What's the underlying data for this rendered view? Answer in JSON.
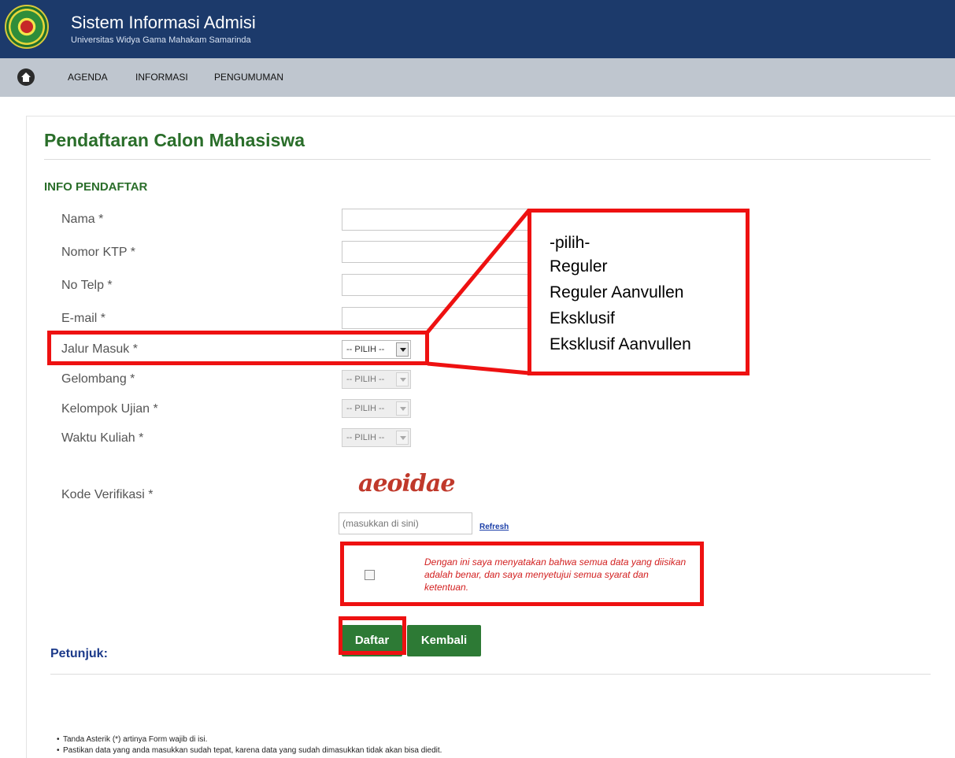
{
  "header": {
    "title": "Sistem Informasi Admisi",
    "subtitle": "Universitas Widya Gama Mahakam Samarinda"
  },
  "nav": {
    "items": [
      "AGENDA",
      "INFORMASI",
      "PENGUMUMAN"
    ]
  },
  "page": {
    "title": "Pendaftaran Calon Mahasiswa",
    "section": "INFO PENDAFTAR"
  },
  "form": {
    "nama_label": "Nama *",
    "ktp_label": "Nomor KTP *",
    "telp_label": "No Telp *",
    "email_label": "E-mail *",
    "jalur_label": "Jalur Masuk *",
    "gelombang_label": "Gelombang *",
    "kelompok_label": "Kelompok Ujian *",
    "waktu_label": "Waktu Kuliah *",
    "kode_label": "Kode Verifikasi *",
    "select_default": "-- PILIH --",
    "captcha_text": "aeoidae",
    "captcha_placeholder": "(masukkan di sini)",
    "refresh_label": "Refresh",
    "agreement": "Dengan ini saya menyatakan bahwa semua data yang diisikan adalah benar, dan saya menyetujui semua syarat dan ketentuan."
  },
  "buttons": {
    "daftar": "Daftar",
    "kembali": "Kembali"
  },
  "petunjuk": {
    "title": "Petunjuk:",
    "items": [
      "Tanda Asterik (*) artinya Form wajib di isi.",
      "Pastikan data yang anda masukkan sudah tepat, karena data yang sudah dimasukkan tidak akan bisa diedit."
    ]
  },
  "dropdown_options": [
    "-pilih-",
    "Reguler",
    "Reguler Aanvullen",
    "Eksklusif",
    "Eksklusif Aanvullen"
  ],
  "colors": {
    "header_bg": "#1c3a6b",
    "nav_bg": "#bfc6cf",
    "accent_green": "#2d7a35",
    "annotation_red": "#ee1111"
  }
}
